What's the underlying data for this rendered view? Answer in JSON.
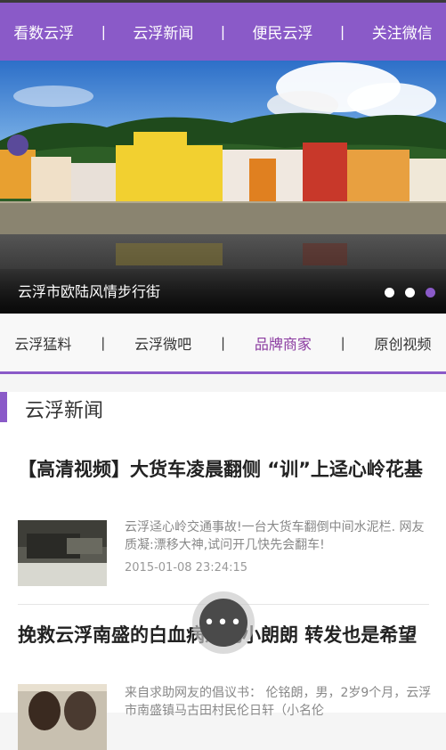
{
  "topnav": {
    "items": [
      "看数云浮",
      "云浮新闻",
      "便民云浮",
      "关注微信"
    ],
    "separator": "|"
  },
  "banner": {
    "caption": "云浮市欧陆风情步行街",
    "slide_count": 3,
    "active_slide": 3
  },
  "subnav": {
    "items": [
      "云浮猛料",
      "云浮微吧",
      "品牌商家",
      "原创视频"
    ],
    "active_index": 2,
    "separator": "|"
  },
  "section": {
    "title": "云浮新闻"
  },
  "news": [
    {
      "title": "【高清视频】大货车凌晨翻侧 “训”上迳心岭花基",
      "summary": "云浮迳心岭交通事故!一台大货车翻倒中间水泥栏. 网友质凝:漂移大神,试问开几快先会翻车!",
      "time": "2015-01-08 23:24:15"
    },
    {
      "title": "挽救云浮南盛的白血病患儿小朗朗 转发也是希望",
      "summary": "来自求助网友的倡议书： 伦铭朗，男，2岁9个月，云浮市南盛镇马古田村民伦日轩（小名伦"
    }
  ],
  "fab": {
    "label": "•••"
  },
  "colors": {
    "accent": "#8a5ac8",
    "active_text": "#8a3aa0"
  }
}
